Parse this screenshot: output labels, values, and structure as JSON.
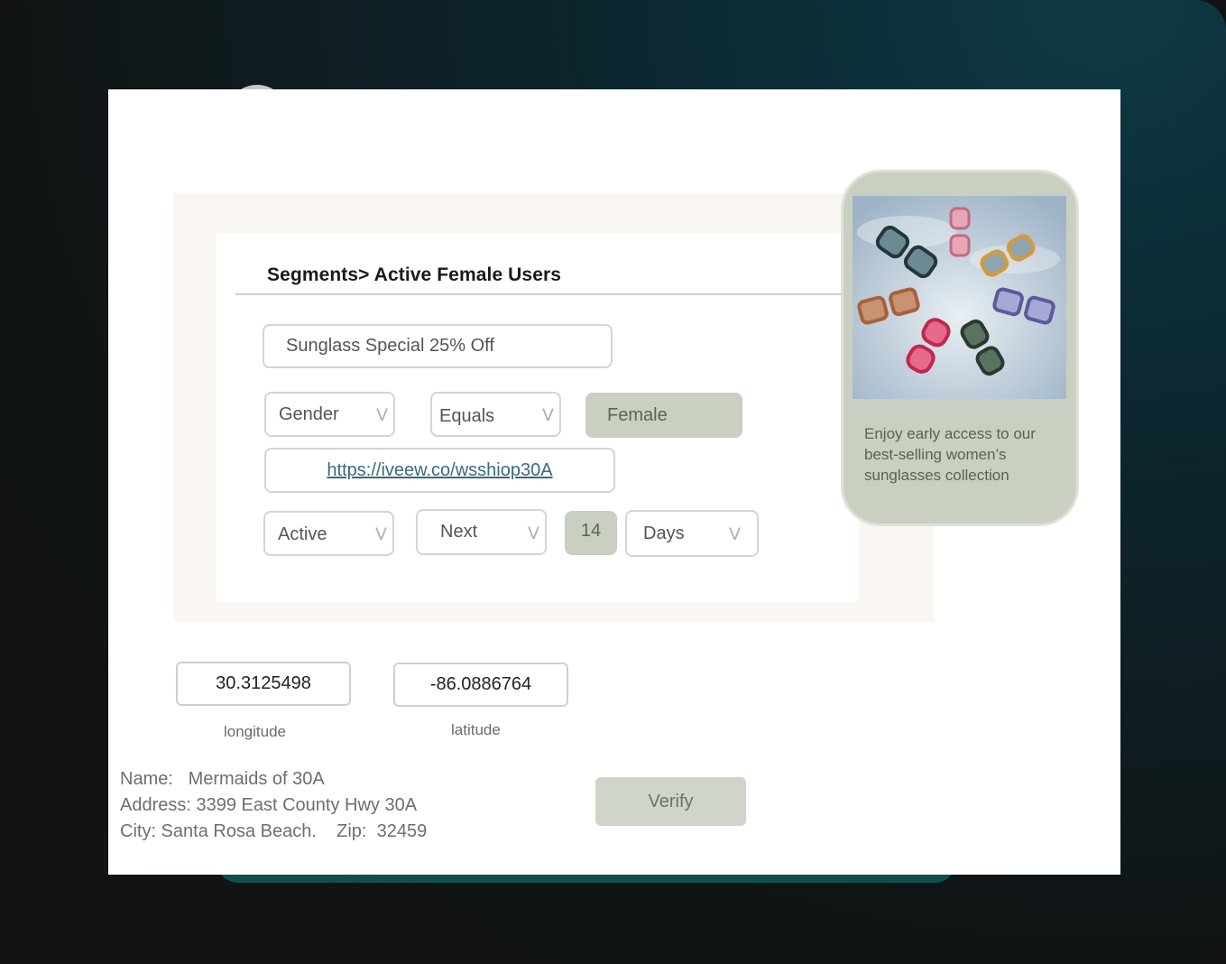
{
  "segment": {
    "breadcrumb": "Segments> Active Female Users",
    "campaign_name": "Sunglass Special 25% Off",
    "filter": {
      "attribute": "Gender",
      "operator": "Equals",
      "value": "Female"
    },
    "link": "https://iveew.co/wsshiop30A",
    "activity": {
      "status": "Active",
      "window": "Next",
      "count": "14",
      "unit": "Days"
    },
    "caret_glyph": "V"
  },
  "location": {
    "longitude_value": "30.3125498",
    "longitude_label": "longitude",
    "latitude_value": "-86.0886764",
    "latitude_label": "latitude"
  },
  "business": {
    "name_line": "Name:   Mermaids of 30A",
    "address_line": "Address: 3399 East County Hwy 30A",
    "city_line": "City: Santa Rosa Beach.    Zip:  32459"
  },
  "verify_label": "Verify",
  "preview": {
    "image_icon": "sunglasses-image",
    "caption": "Enjoy early access to our best-selling women’s sunglasses collection"
  },
  "colors": {
    "accent_green": "#c9cfc1",
    "link_color": "#3b6a78"
  }
}
